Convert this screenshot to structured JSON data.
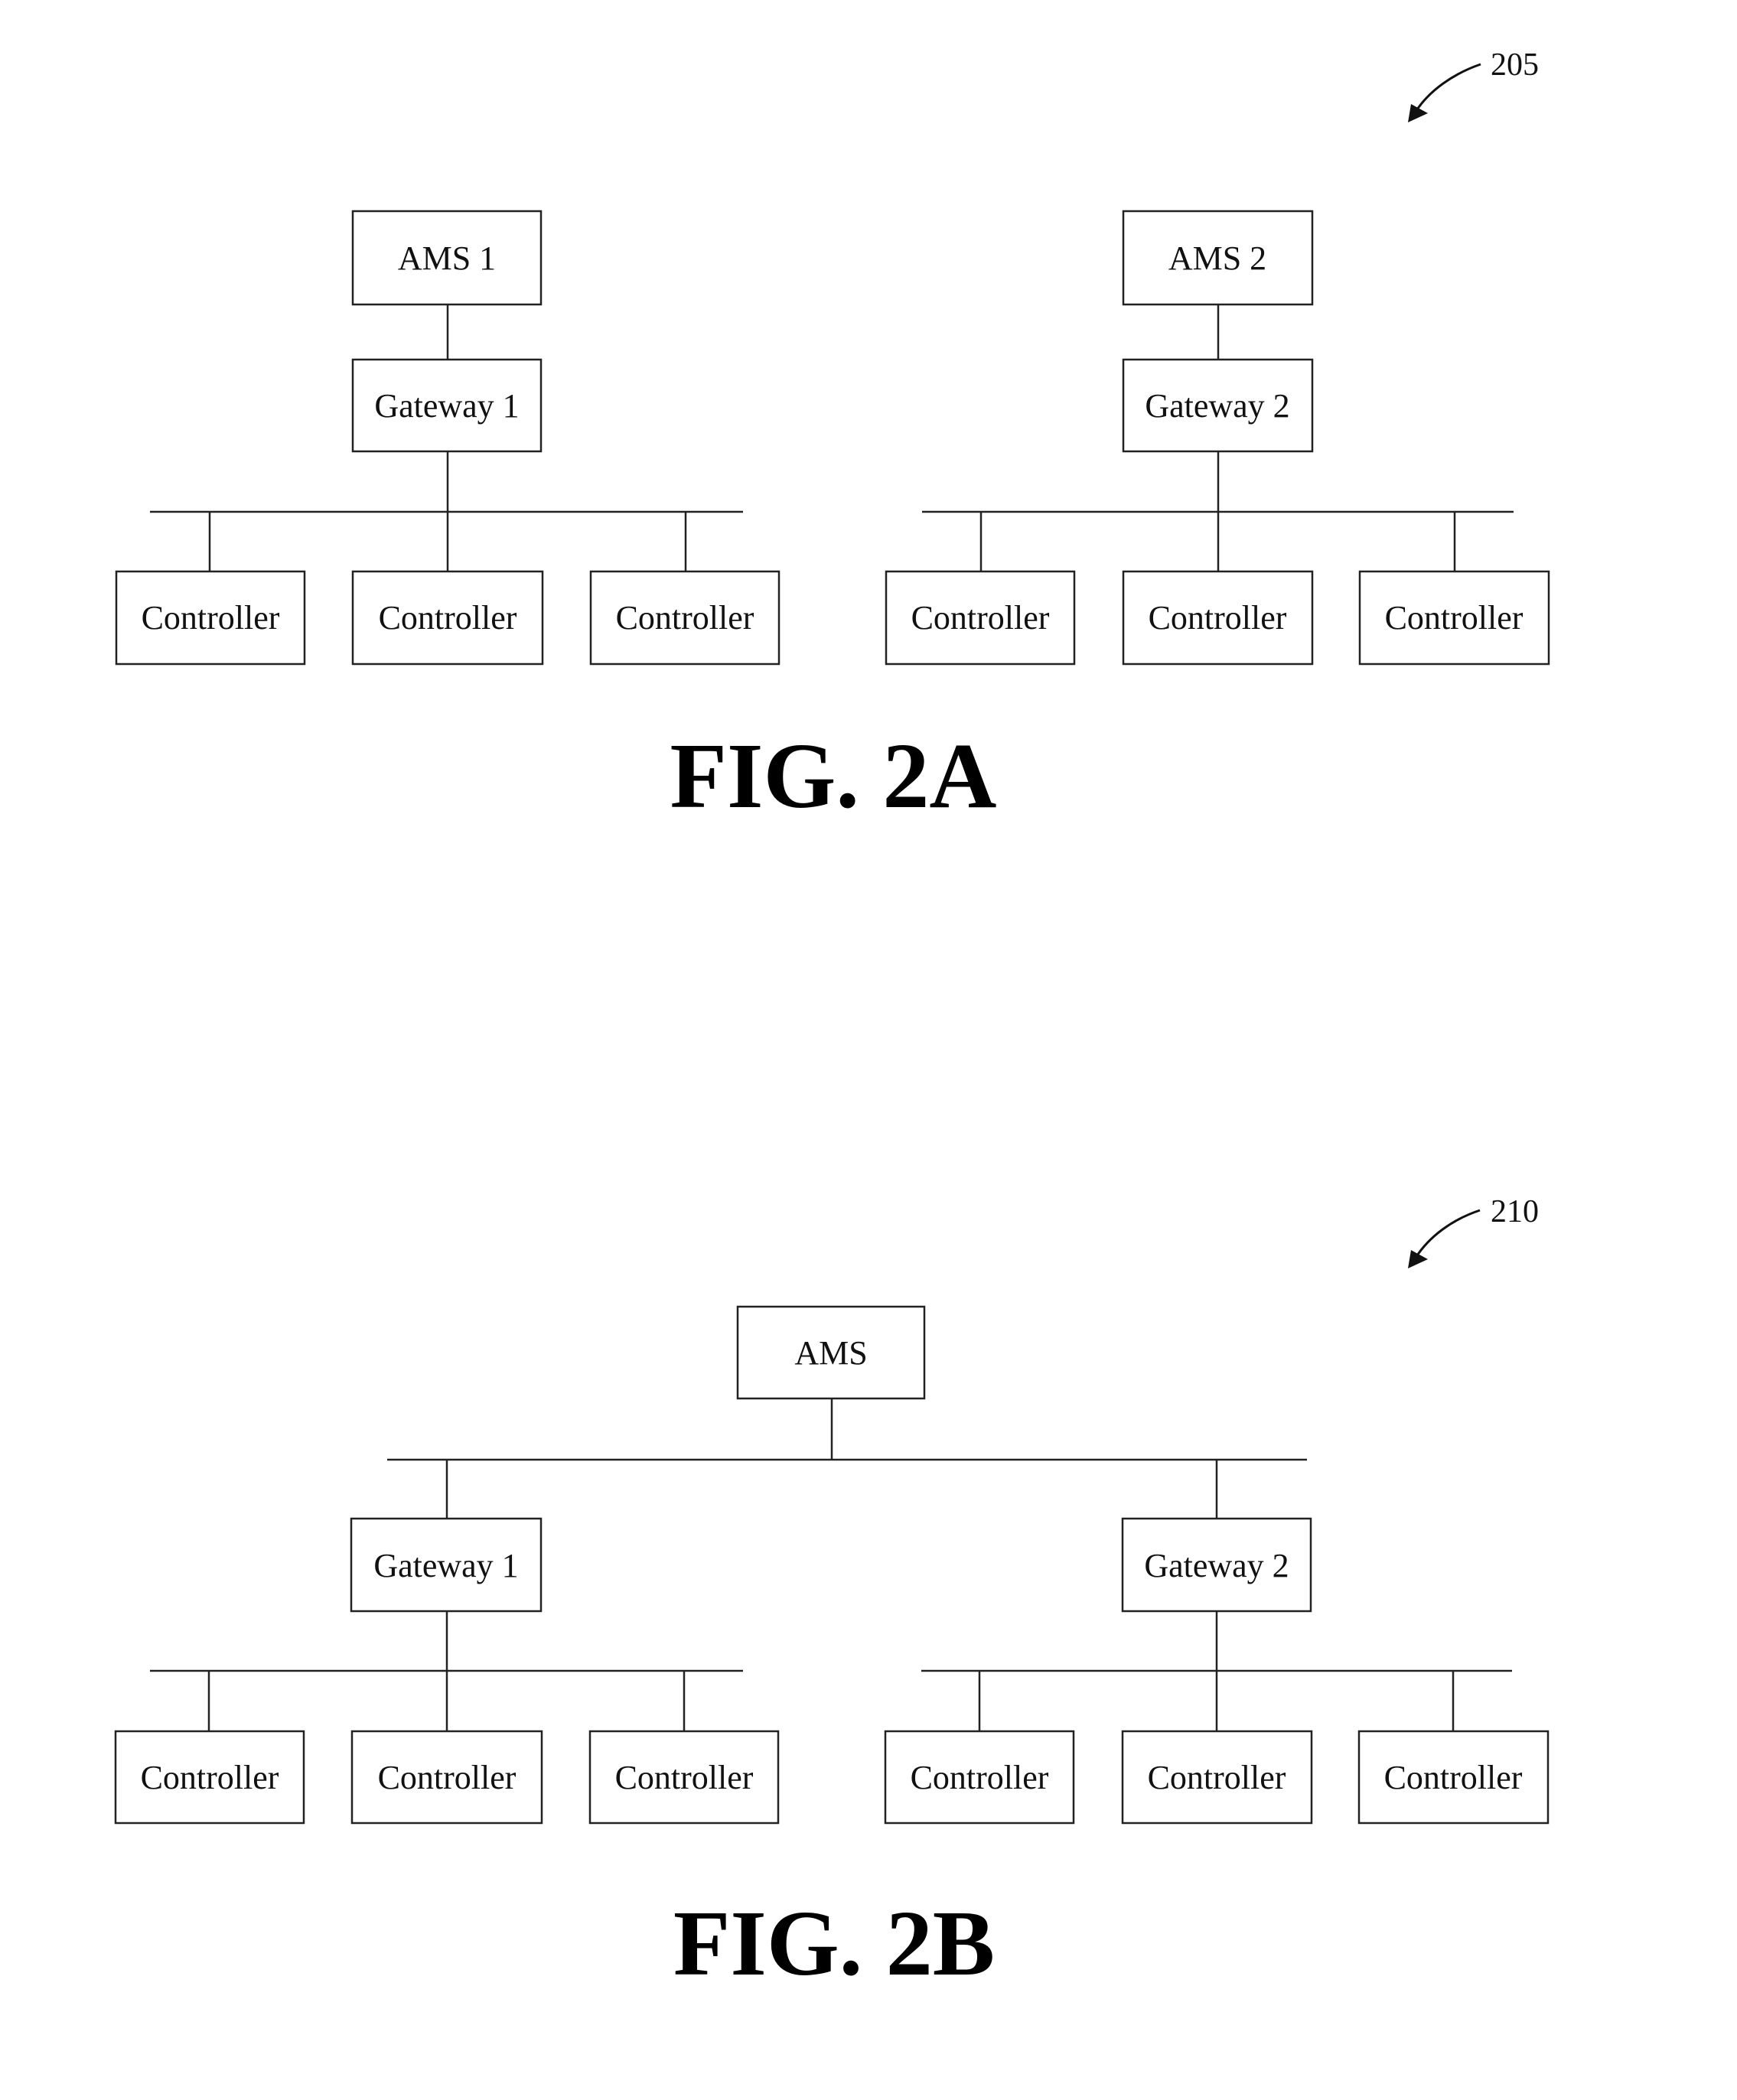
{
  "figures": [
    {
      "id": "fig2a",
      "title": "FIG. 2A",
      "reference_numeral": "205",
      "description": "Two independent AMS systems, each with its own gateway and controllers",
      "nodes": [
        {
          "id": "ams1",
          "label": "AMS 1",
          "type": "ams"
        },
        {
          "id": "gw1",
          "label": "Gateway 1",
          "type": "gateway"
        },
        {
          "id": "c1",
          "label": "Controller",
          "type": "controller"
        },
        {
          "id": "c2",
          "label": "Controller",
          "type": "controller"
        },
        {
          "id": "c3",
          "label": "Controller",
          "type": "controller"
        },
        {
          "id": "ams2",
          "label": "AMS 2",
          "type": "ams"
        },
        {
          "id": "gw2",
          "label": "Gateway 2",
          "type": "gateway"
        },
        {
          "id": "c4",
          "label": "Controller",
          "type": "controller"
        },
        {
          "id": "c5",
          "label": "Controller",
          "type": "controller"
        },
        {
          "id": "c6",
          "label": "Controller",
          "type": "controller"
        }
      ],
      "edges": [
        [
          "ams1",
          "gw1"
        ],
        [
          "gw1",
          "c1"
        ],
        [
          "gw1",
          "c2"
        ],
        [
          "gw1",
          "c3"
        ],
        [
          "ams2",
          "gw2"
        ],
        [
          "gw2",
          "c4"
        ],
        [
          "gw2",
          "c5"
        ],
        [
          "gw2",
          "c6"
        ]
      ]
    },
    {
      "id": "fig2b",
      "title": "FIG. 2B",
      "reference_numeral": "210",
      "description": "Single AMS connected to two gateways, each with controllers",
      "nodes": [
        {
          "id": "ams",
          "label": "AMS",
          "type": "ams"
        },
        {
          "id": "gw1",
          "label": "Gateway 1",
          "type": "gateway"
        },
        {
          "id": "gw2",
          "label": "Gateway 2",
          "type": "gateway"
        },
        {
          "id": "c1",
          "label": "Controller",
          "type": "controller"
        },
        {
          "id": "c2",
          "label": "Controller",
          "type": "controller"
        },
        {
          "id": "c3",
          "label": "Controller",
          "type": "controller"
        },
        {
          "id": "c4",
          "label": "Controller",
          "type": "controller"
        },
        {
          "id": "c5",
          "label": "Controller",
          "type": "controller"
        },
        {
          "id": "c6",
          "label": "Controller",
          "type": "controller"
        }
      ],
      "edges": [
        [
          "ams",
          "gw1"
        ],
        [
          "ams",
          "gw2"
        ],
        [
          "gw1",
          "c1"
        ],
        [
          "gw1",
          "c2"
        ],
        [
          "gw1",
          "c3"
        ],
        [
          "gw2",
          "c4"
        ],
        [
          "gw2",
          "c5"
        ],
        [
          "gw2",
          "c6"
        ]
      ]
    }
  ]
}
